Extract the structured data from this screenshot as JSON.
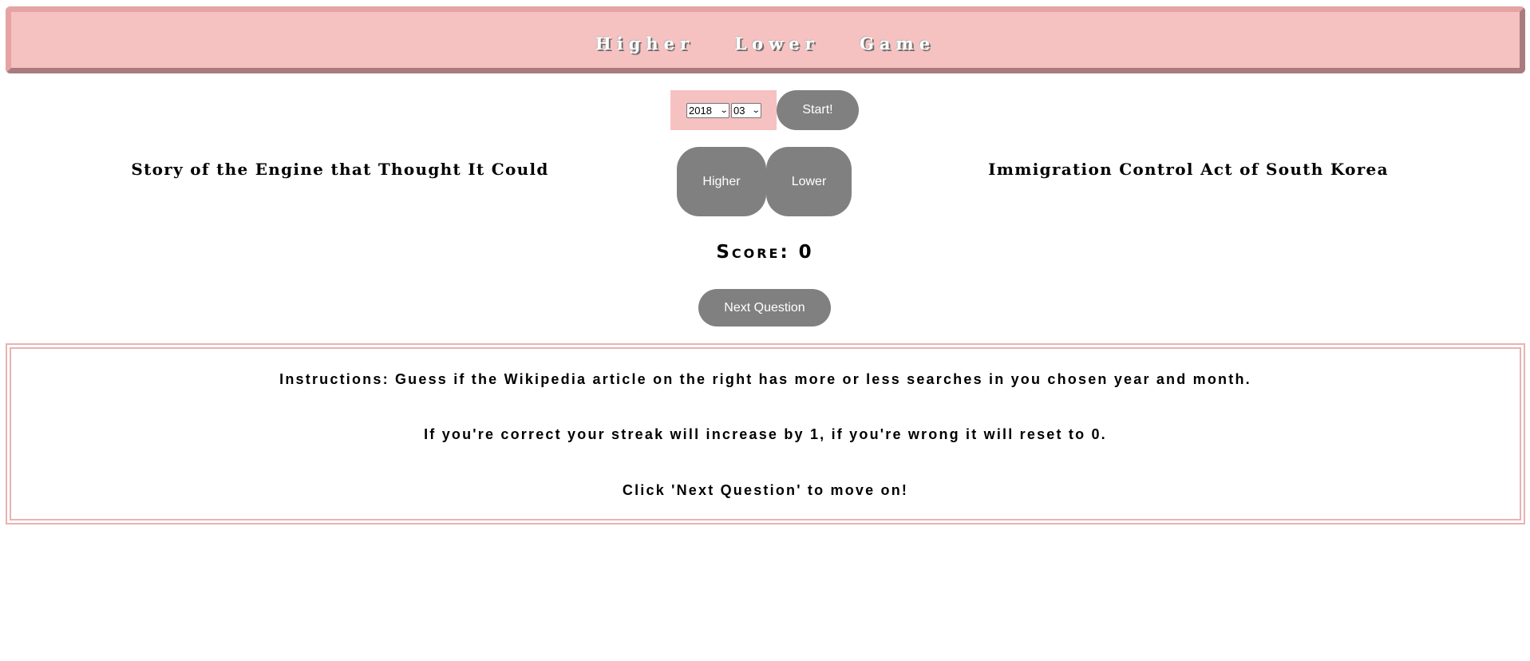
{
  "header": {
    "title": "Higher Lower Game"
  },
  "controls": {
    "year_selected": "2018",
    "month_selected": "03",
    "start_label": "Start!"
  },
  "game": {
    "left_article": "Story of the Engine that Thought It Could",
    "right_article": "Immigration Control Act of South Korea",
    "higher_label": "Higher",
    "lower_label": "Lower",
    "score_text": "Score: 0",
    "next_label": "Next Question"
  },
  "instructions": {
    "line1": "Instructions: Guess if the Wikipedia article on the right has more or less searches in you chosen year and month.",
    "line2": "If you're correct your streak will increase by 1, if you're wrong it will reset to 0.",
    "line3": "Click 'Next Question' to move on!"
  },
  "colors": {
    "banner_bg": "#f6c1c1",
    "button_bg": "#808080",
    "instructions_border": "#eab2b2"
  }
}
